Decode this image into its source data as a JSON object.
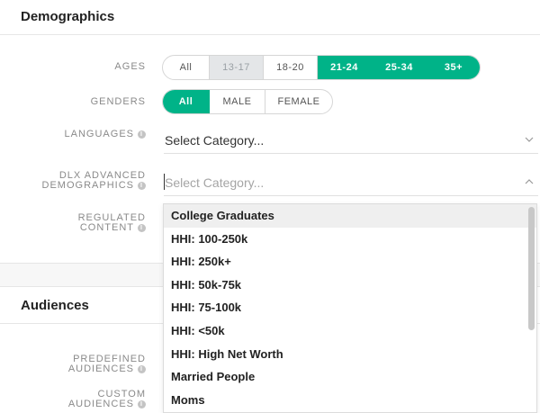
{
  "demographics": {
    "title": "Demographics",
    "ages": {
      "label": "AGES",
      "options": [
        {
          "label": "All",
          "state": "off"
        },
        {
          "label": "13-17",
          "state": "disabled"
        },
        {
          "label": "18-20",
          "state": "off"
        },
        {
          "label": "21-24",
          "state": "on"
        },
        {
          "label": "25-34",
          "state": "on"
        },
        {
          "label": "35+",
          "state": "on"
        }
      ]
    },
    "genders": {
      "label": "GENDERS",
      "options": [
        {
          "label": "All",
          "state": "on"
        },
        {
          "label": "MALE",
          "state": "off"
        },
        {
          "label": "FEMALE",
          "state": "off"
        }
      ]
    },
    "languages": {
      "label": "LANGUAGES",
      "value": "Select Category..."
    },
    "dlx": {
      "label_line1": "DLX ADVANCED",
      "label_line2": "DEMOGRAPHICS",
      "placeholder": "Select Category..."
    },
    "regulated": {
      "label_line1": "REGULATED",
      "label_line2": "CONTENT"
    }
  },
  "dropdown": {
    "highlighted_index": 0,
    "options": [
      "College Graduates",
      "HHI: 100-250k",
      "HHI: 250k+",
      "HHI: 50k-75k",
      "HHI: 75-100k",
      "HHI: <50k",
      "HHI: High Net Worth",
      "Married People",
      "Moms"
    ]
  },
  "audiences": {
    "title": "Audiences",
    "predefined": {
      "label_line1": "PREDEFINED",
      "label_line2": "AUDIENCES"
    },
    "custom": {
      "label_line1": "CUSTOM",
      "label_line2": "AUDIENCES"
    }
  },
  "info_icon_glyph": "i",
  "colors": {
    "accent": "#00b388",
    "disabled": "#e4e6e8"
  }
}
